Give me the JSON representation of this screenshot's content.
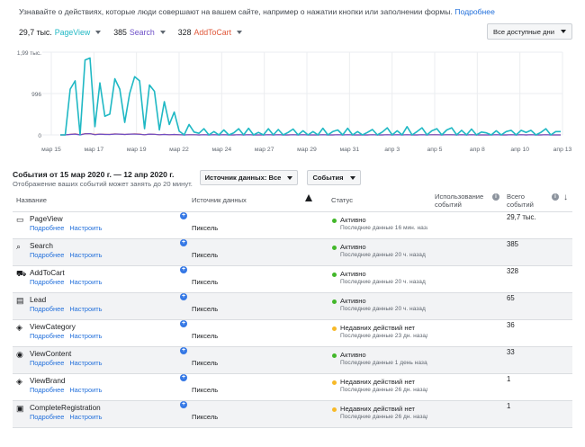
{
  "intro": {
    "text": "Узнавайте о действиях, которые люди совершают на вашем сайте, например о нажатии кнопки или заполнении формы.",
    "link": "Подробнее"
  },
  "metrics": [
    {
      "value": "29,7 тыс.",
      "name": "PageView",
      "color": "#1fb8c4"
    },
    {
      "value": "385",
      "name": "Search",
      "color": "#6d4fc7"
    },
    {
      "value": "328",
      "name": "AddToCart",
      "color": "#e0593b"
    }
  ],
  "range_button": {
    "label": "Все доступные дни"
  },
  "chart_data": {
    "type": "line",
    "ytick_labels": [
      "1,99 тыс.",
      "996",
      "0"
    ],
    "yticks": [
      1990,
      996,
      0
    ],
    "ylim": [
      0,
      1990
    ],
    "x_tick_labels": [
      "мар 15",
      "мар 17",
      "мар 19",
      "мар 22",
      "мар 24",
      "мар 27",
      "мар 29",
      "мар 31",
      "апр 3",
      "апр 5",
      "апр 8",
      "апр 10",
      "апр 13"
    ],
    "grid": true,
    "series": [
      {
        "name": "PageView",
        "color": "#1fb8c4",
        "values": [
          0,
          0,
          1100,
          1300,
          0,
          1800,
          1850,
          200,
          1250,
          450,
          500,
          1350,
          1100,
          300,
          1000,
          1400,
          1300,
          150,
          1200,
          1050,
          120,
          800,
          250,
          550,
          90,
          0,
          250,
          70,
          40,
          150,
          0,
          80,
          0,
          120,
          0,
          50,
          150,
          0,
          160,
          0,
          60,
          0,
          150,
          0,
          130,
          0,
          60,
          140,
          0,
          100,
          0,
          80,
          0,
          160,
          0,
          80,
          120,
          0,
          160,
          0,
          80,
          0,
          60,
          130,
          0,
          70,
          170,
          0,
          100,
          0,
          200,
          0,
          80,
          170,
          0,
          100,
          150,
          0,
          120,
          170,
          0,
          110,
          0,
          140,
          0,
          70,
          50,
          0,
          100,
          0,
          80,
          110,
          0,
          110,
          60,
          110,
          0,
          60,
          150,
          0,
          80,
          80
        ]
      },
      {
        "name": "Search",
        "color": "#6d4fc7",
        "values": [
          0,
          0,
          10,
          20,
          0,
          25,
          30,
          5,
          20,
          10,
          10,
          20,
          20,
          10,
          20,
          20,
          15,
          5,
          20,
          15,
          5,
          10,
          5,
          10,
          5,
          0,
          5,
          5,
          0,
          5,
          0,
          5,
          0,
          5,
          0,
          0,
          5,
          0,
          5,
          0,
          0,
          0,
          5,
          0,
          5,
          0,
          0,
          5,
          0,
          5,
          0,
          0,
          0,
          5,
          0,
          0,
          5,
          0,
          5,
          0,
          0,
          0,
          0,
          5,
          0,
          0,
          5,
          0,
          5,
          0,
          5,
          0,
          0,
          5,
          0,
          5,
          5,
          0,
          5,
          5,
          0,
          5,
          0,
          5,
          0,
          0,
          0,
          0,
          5,
          0,
          0,
          5,
          0,
          5,
          0,
          5,
          0,
          0,
          5,
          0,
          0,
          0
        ]
      },
      {
        "name": "AddToCart",
        "color": "#e0593b",
        "values": [
          0,
          0,
          15,
          25,
          5,
          30,
          30,
          10,
          20,
          15,
          10,
          25,
          20,
          10,
          20,
          25,
          20,
          5,
          20,
          15,
          5,
          15,
          5,
          10,
          5,
          0,
          5,
          5,
          0,
          5,
          0,
          5,
          0,
          5,
          0,
          0,
          5,
          0,
          5,
          0,
          0,
          0,
          5,
          0,
          5,
          0,
          0,
          5,
          0,
          5,
          0,
          0,
          0,
          5,
          0,
          0,
          5,
          0,
          5,
          0,
          0,
          0,
          0,
          5,
          0,
          0,
          5,
          0,
          5,
          0,
          5,
          0,
          0,
          5,
          0,
          5,
          5,
          0,
          5,
          5,
          0,
          5,
          0,
          5,
          0,
          0,
          0,
          0,
          5,
          0,
          0,
          5,
          0,
          5,
          0,
          5,
          0,
          0,
          5,
          0,
          0,
          0
        ]
      }
    ]
  },
  "section": {
    "title": "События от 15 мар 2020 г. — 12 апр 2020 г.",
    "subtitle": "Отображение ваших событий может занять до 20 минут."
  },
  "buttons": {
    "source": "Источник данных: Все",
    "events": "События"
  },
  "table": {
    "headers": {
      "name": "Название",
      "source": "Источник данных",
      "status": "Статус",
      "usage": "Использование событий",
      "total": "Всего событий"
    },
    "info_icon": "i",
    "rows": [
      {
        "icon": "page-icon",
        "glyph": "▭",
        "name": "PageView",
        "link1": "Подробнее",
        "link2": "Настроить",
        "plus": "+",
        "source": "Пиксель",
        "status": "Активно",
        "status_color": "#42b72a",
        "status_sub": "Последние данные 16 мин. назад",
        "count": "29,7 тыс."
      },
      {
        "icon": "search-icon",
        "glyph": "⌕",
        "name": "Search",
        "link1": "Подробнее",
        "link2": "Настроить",
        "plus": "+",
        "source": "Пиксель",
        "status": "Активно",
        "status_color": "#42b72a",
        "status_sub": "Последние данные 20 ч. назад",
        "count": "385"
      },
      {
        "icon": "cart-icon",
        "glyph": "⛟",
        "name": "AddToCart",
        "link1": "Подробнее",
        "link2": "Настроить",
        "plus": "+",
        "source": "Пиксель",
        "status": "Активно",
        "status_color": "#42b72a",
        "status_sub": "Последние данные 20 ч. назад",
        "count": "328"
      },
      {
        "icon": "lead-card-icon",
        "glyph": "▤",
        "name": "Lead",
        "link1": "Подробнее",
        "link2": "Настроить",
        "plus": "+",
        "source": "Пиксель",
        "status": "Активно",
        "status_color": "#42b72a",
        "status_sub": "Последние данные 20 ч. назад",
        "count": "65"
      },
      {
        "icon": "tag-icon",
        "glyph": "◈",
        "name": "ViewCategory",
        "link1": "Подробнее",
        "link2": "Настроить",
        "plus": "+",
        "source": "Пиксель",
        "status": "Недавних действий нет",
        "status_color": "#f7b928",
        "status_sub": "Последние данные 23 дн. назад",
        "count": "36"
      },
      {
        "icon": "eye-icon",
        "glyph": "◉",
        "name": "ViewContent",
        "link1": "Подробнее",
        "link2": "Настроить",
        "plus": "+",
        "source": "Пиксель",
        "status": "Активно",
        "status_color": "#42b72a",
        "status_sub": "Последние данные 1 день назад",
        "count": "33"
      },
      {
        "icon": "tag-icon",
        "glyph": "◈",
        "name": "ViewBrand",
        "link1": "Подробнее",
        "link2": "Настроить",
        "plus": "+",
        "source": "Пиксель",
        "status": "Недавних действий нет",
        "status_color": "#f7b928",
        "status_sub": "Последние данные 26 дн. назад",
        "count": "1"
      },
      {
        "icon": "registration-icon",
        "glyph": "▣",
        "name": "CompleteRegistration",
        "link1": "Подробнее",
        "link2": "Настроить",
        "plus": "+",
        "source": "Пиксель",
        "status": "Недавних действий нет",
        "status_color": "#f7b928",
        "status_sub": "Последние данные 26 дн. назад",
        "count": "1"
      }
    ]
  }
}
